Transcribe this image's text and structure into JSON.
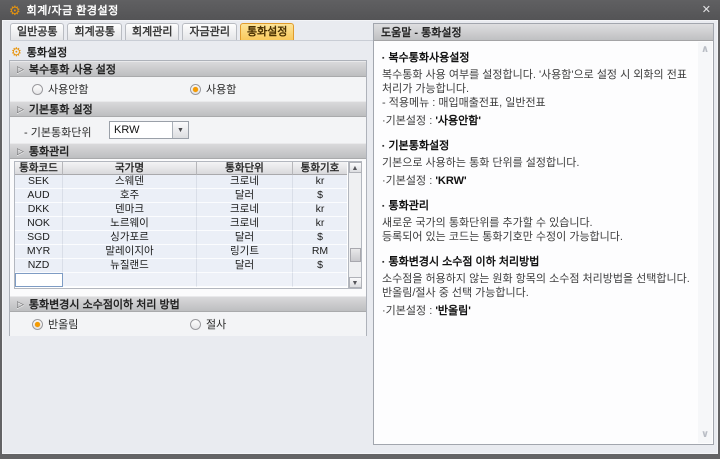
{
  "window": {
    "title": "회계/자금 환경설정",
    "close_label": "✕"
  },
  "tabs": [
    {
      "label": "일반공통",
      "active": false
    },
    {
      "label": "회계공통",
      "active": false
    },
    {
      "label": "회계관리",
      "active": false
    },
    {
      "label": "자금관리",
      "active": false
    },
    {
      "label": "통화설정",
      "active": true
    }
  ],
  "left_panel": {
    "title": "통화설정",
    "sections": {
      "multi_currency": {
        "header": "복수통화 사용 설정",
        "options": [
          {
            "label": "사용안함",
            "selected": false
          },
          {
            "label": "사용함",
            "selected": true
          }
        ]
      },
      "base_currency": {
        "header": "기본통화 설정",
        "field_label": "- 기본통화단위",
        "value": "KRW"
      },
      "currency_table": {
        "header": "통화관리",
        "columns": [
          "통화코드",
          "국가명",
          "통화단위",
          "통화기호"
        ],
        "rows": [
          [
            "SEK",
            "스웨덴",
            "크로네",
            "kr"
          ],
          [
            "AUD",
            "호주",
            "달러",
            "$"
          ],
          [
            "DKK",
            "덴마크",
            "크로네",
            "kr"
          ],
          [
            "NOK",
            "노르웨이",
            "크로네",
            "kr"
          ],
          [
            "SGD",
            "싱가포르",
            "달러",
            "$"
          ],
          [
            "MYR",
            "말레이지아",
            "링기트",
            "RM"
          ],
          [
            "NZD",
            "뉴질랜드",
            "달러",
            "$"
          ]
        ]
      },
      "decimal_method": {
        "header": "통화변경시 소수점이하 처리 방법",
        "options": [
          {
            "label": "반올림",
            "selected": true
          },
          {
            "label": "절사",
            "selected": false
          }
        ]
      }
    }
  },
  "help_panel": {
    "header": "도움말 - 통화설정",
    "topics": [
      {
        "title": "복수통화사용설정",
        "lines": [
          "복수통화 사용 여부를 설정합니다. '사용함'으로 설정 시 외화의 전표처리가 가능합니다.",
          "- 적용메뉴 : 매입매출전표, 일반전표"
        ],
        "default_prefix": "·기본설정 : ",
        "default_value": "'사용안함'"
      },
      {
        "title": "기본통화설정",
        "lines": [
          "기본으로 사용하는 통화 단위를 설정합니다."
        ],
        "default_prefix": "·기본설정 : ",
        "default_value": "'KRW'"
      },
      {
        "title": "통화관리",
        "lines": [
          "새로운 국가의 통화단위를 추가할 수 있습니다.",
          "등록되어 있는 코드는 통화기호만 수정이 가능합니다."
        ]
      },
      {
        "title": "통화변경시 소수점 이하 처리방법",
        "lines": [
          "소수점을 허용하지 않는 원화 항목의 소수점 처리방법을 선택합니다. 반올림/절사 중 선택 가능합니다."
        ],
        "default_prefix": "·기본설정 : ",
        "default_value": "'반올림'"
      }
    ]
  },
  "icons": {
    "gear": "⚙",
    "triangle": "▷",
    "bullet": "▪",
    "combo_arrow": "▼",
    "scroll_up": "▲",
    "scroll_down": "▼",
    "chev_up": "∧",
    "chev_down": "∨"
  },
  "colors": {
    "titlebar": "#58585a",
    "accent_orange": "#e8940d",
    "active_tab": "#f9c95c",
    "radio_selected": "#f59b00",
    "panel_bg": "#e9ebf0",
    "row_bg": "#ebeff7"
  }
}
